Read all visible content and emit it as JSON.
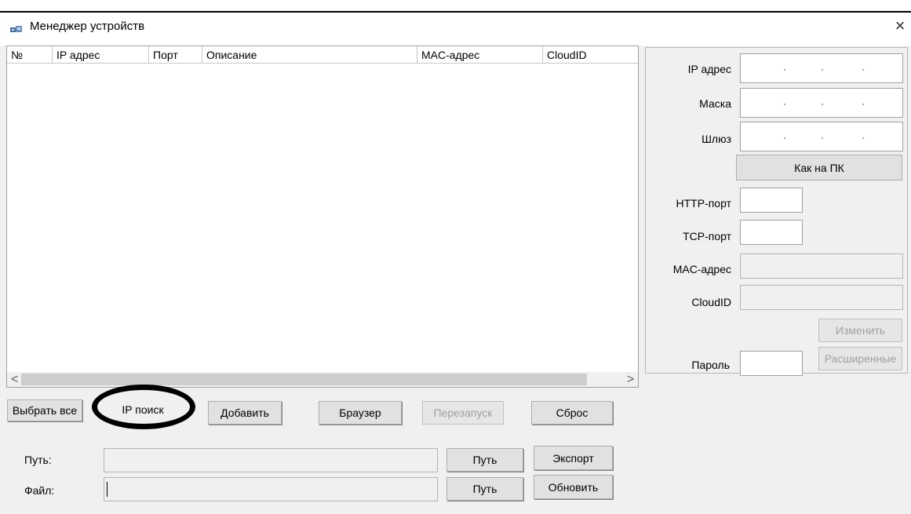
{
  "window": {
    "title": "Менеджер устройств",
    "close_glyph": "×",
    "icon": "devices-icon"
  },
  "device_list": {
    "columns": [
      "№",
      "IP адрес",
      "Порт",
      "Описание",
      "MAC-адрес",
      "CloudID"
    ],
    "rows": [],
    "scroll_left": "<",
    "scroll_right": ">"
  },
  "settings": {
    "ip_label": "IP адрес",
    "mask_label": "Маска",
    "gateway_label": "Шлюз",
    "same_as_pc_button": "Как на ПК",
    "http_port_label": "HTTP-порт",
    "tcp_port_label": "TCP-порт",
    "mac_label": "MAC-адрес",
    "cloudid_label": "CloudID",
    "modify_button": "Изменить",
    "password_label": "Пароль",
    "advanced_button": "Расширенные"
  },
  "actions": {
    "select_all": "Выбрать все",
    "ip_search": "IP поиск",
    "add": "Добавить",
    "browser": "Браузер",
    "restart": "Перезапуск",
    "reset": "Сброс"
  },
  "export": {
    "path_label": "Путь:",
    "path_value": "",
    "path_button": "Путь",
    "export_button": "Экспорт",
    "file_label": "Файл:",
    "file_value": "",
    "file_path_button": "Путь",
    "update_button": "Обновить"
  }
}
